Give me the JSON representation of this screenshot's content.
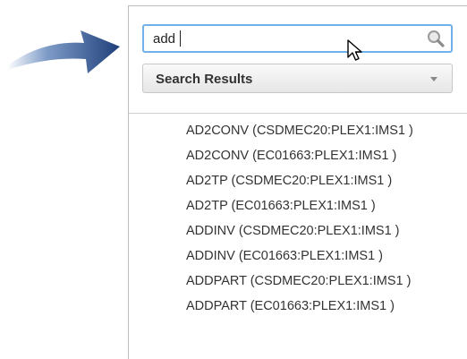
{
  "search": {
    "value": "add",
    "icon": "search-icon"
  },
  "dropdown": {
    "label": "Search Results",
    "icon": "chevron-down-icon"
  },
  "results": [
    "AD2CONV (CSDMEC20:PLEX1:IMS1 )",
    "AD2CONV (EC01663:PLEX1:IMS1 )",
    "AD2TP (CSDMEC20:PLEX1:IMS1 )",
    "AD2TP (EC01663:PLEX1:IMS1 )",
    "ADDINV (CSDMEC20:PLEX1:IMS1 )",
    "ADDINV (EC01663:PLEX1:IMS1 )",
    "ADDPART (CSDMEC20:PLEX1:IMS1 )",
    "ADDPART (EC01663:PLEX1:IMS1 )"
  ],
  "colors": {
    "arrow": "#2c4f8c",
    "search_focus_border": "#6fb1e8",
    "result_text": "#333333"
  }
}
